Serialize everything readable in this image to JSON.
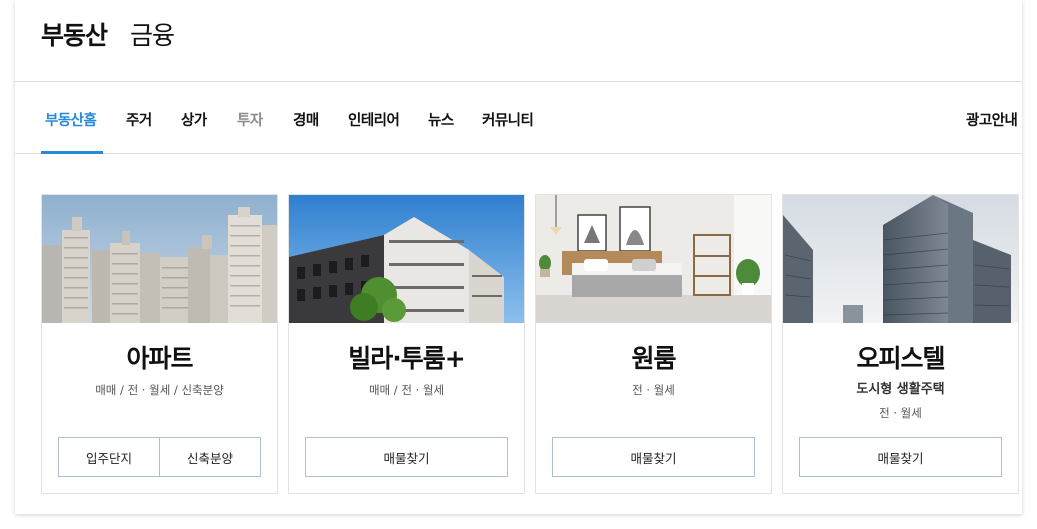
{
  "header": {
    "title": "부동산",
    "subtitle": "금융"
  },
  "nav": {
    "items": [
      {
        "label": "부동산홈"
      },
      {
        "label": "주거"
      },
      {
        "label": "상가"
      },
      {
        "label": "투자"
      },
      {
        "label": "경매"
      },
      {
        "label": "인테리어"
      },
      {
        "label": "뉴스"
      },
      {
        "label": "커뮤니티"
      }
    ],
    "ad_label": "광고안내",
    "accent_color": "#2a8ad8"
  },
  "cards": [
    {
      "title": "아파트",
      "desc": "매매 / 전 · 월세 / 신축분양",
      "buttons": [
        "입주단지",
        "신축분양"
      ]
    },
    {
      "title": "빌라·투룸+",
      "desc": "매매 / 전 · 월세",
      "buttons": [
        "매물찾기"
      ]
    },
    {
      "title": "원룸",
      "desc": "전 · 월세",
      "buttons": [
        "매물찾기"
      ]
    },
    {
      "title": "오피스텔",
      "tagline": "도시형 생활주택",
      "desc": "전 · 월세",
      "buttons": [
        "매물찾기"
      ]
    }
  ]
}
